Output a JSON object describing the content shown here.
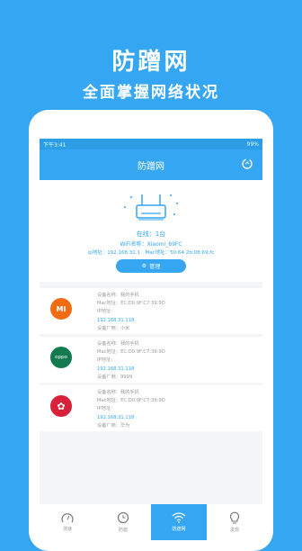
{
  "promo": {
    "title": "防蹭网",
    "subtitle": "全面掌握网络状况"
  },
  "status": {
    "time": "下午3:41",
    "battery": "99%"
  },
  "app": {
    "title": "防蹭网"
  },
  "router": {
    "online": "在线：1台",
    "wifi_name": "WiFi名称：Xiaomi_69FC",
    "ip_line": "ip地址：192.168.31.1　Mac地址：50:64:2b:08:69:fc",
    "manage_label": "管理"
  },
  "devices": [
    {
      "brand": "mi-logo",
      "brand_text": "MI",
      "color": "#f26b12",
      "name": "设备名称：我的手机",
      "mac": "Mac地址：EC:D0:9F:C7:39:9D",
      "ip_label": "IP地址：",
      "ip": "192.168.31.118",
      "vendor": "设备厂商：小米"
    },
    {
      "brand": "oppo-logo",
      "brand_text": "oppo",
      "color": "#137a4f",
      "name": "设备名称：我的手机",
      "mac": "Mac地址：EC:D0:9F:C7:39:9D",
      "ip_label": "IP地址：",
      "ip": "192.168.31.118",
      "vendor": "设备厂商：9999"
    },
    {
      "brand": "huawei-logo",
      "brand_text": "✿",
      "color": "#d8213a",
      "name": "设备名称：我的手机",
      "mac": "Mac地址：EC:D0:9F:C7:39:9D",
      "ip_label": "IP地址：",
      "ip": "192.168.31.118",
      "vendor": "设备厂商：华为"
    }
  ],
  "tabs": [
    {
      "label": "测速",
      "icon": "speedometer-icon"
    },
    {
      "label": "防蹭",
      "icon": "clock-icon"
    },
    {
      "label": "防蹭网",
      "icon": "wifi-icon"
    },
    {
      "label": "发现",
      "icon": "bulb-icon"
    }
  ],
  "colors": {
    "accent": "#35a6f2"
  }
}
